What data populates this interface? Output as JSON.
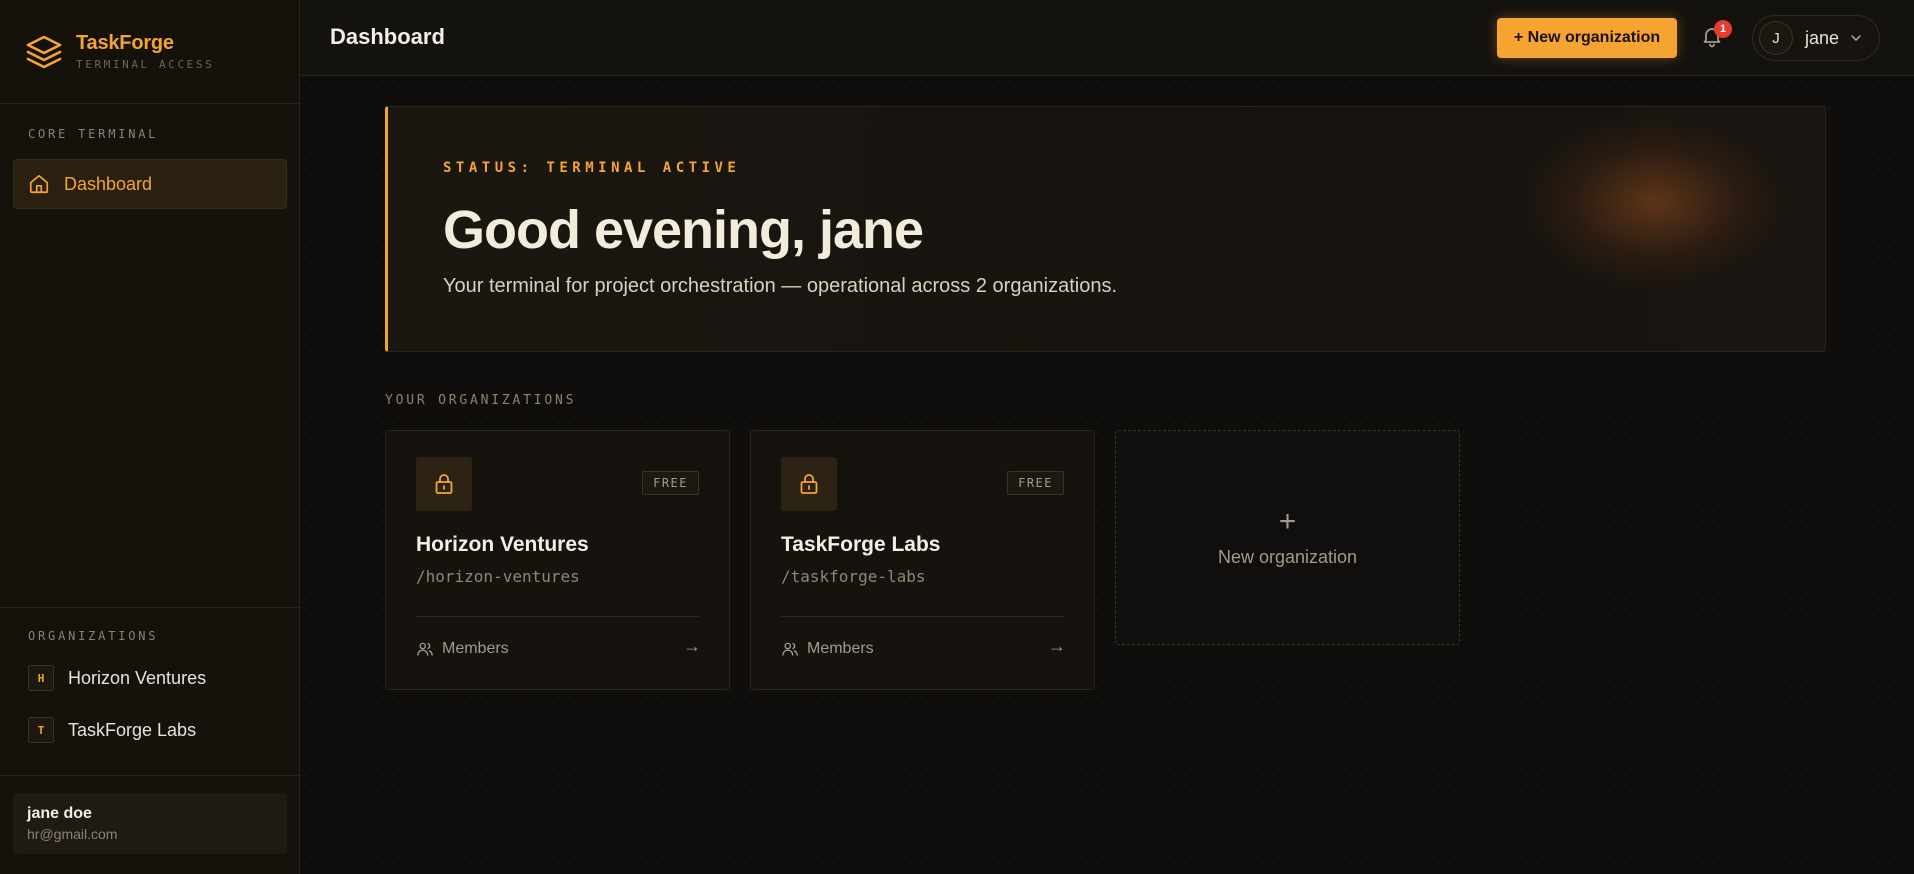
{
  "brand": {
    "name": "TaskForge",
    "subtitle": "TERMINAL ACCESS"
  },
  "sidebar": {
    "core_label": "CORE TERMINAL",
    "nav": [
      {
        "label": "Dashboard",
        "icon": "home-icon",
        "active": true
      }
    ],
    "orgs_label": "ORGANIZATIONS",
    "orgs": [
      {
        "initial": "H",
        "name": "Horizon Ventures"
      },
      {
        "initial": "T",
        "name": "TaskForge Labs"
      }
    ],
    "user": {
      "name": "jane doe",
      "email": "hr@gmail.com"
    }
  },
  "topbar": {
    "title": "Dashboard",
    "new_org_button": "+ New organization",
    "notification_count": "1",
    "user_initial": "J",
    "user_name": "jane"
  },
  "hero": {
    "status": "STATUS: TERMINAL ACTIVE",
    "title": "Good evening, jane",
    "subtitle": "Your terminal for project orchestration — operational across 2 organizations."
  },
  "organizations": {
    "section_label": "YOUR ORGANIZATIONS",
    "cards": [
      {
        "name": "Horizon Ventures",
        "slug": "/horizon-ventures",
        "plan": "FREE",
        "members_label": "Members",
        "arrow": "→"
      },
      {
        "name": "TaskForge Labs",
        "slug": "/taskforge-labs",
        "plan": "FREE",
        "members_label": "Members",
        "arrow": "→"
      }
    ],
    "new_card": {
      "plus": "+",
      "label": "New organization"
    }
  },
  "colors": {
    "accent": "#f5a431",
    "background": "#0f0e0c",
    "badge": "#e53b30"
  }
}
